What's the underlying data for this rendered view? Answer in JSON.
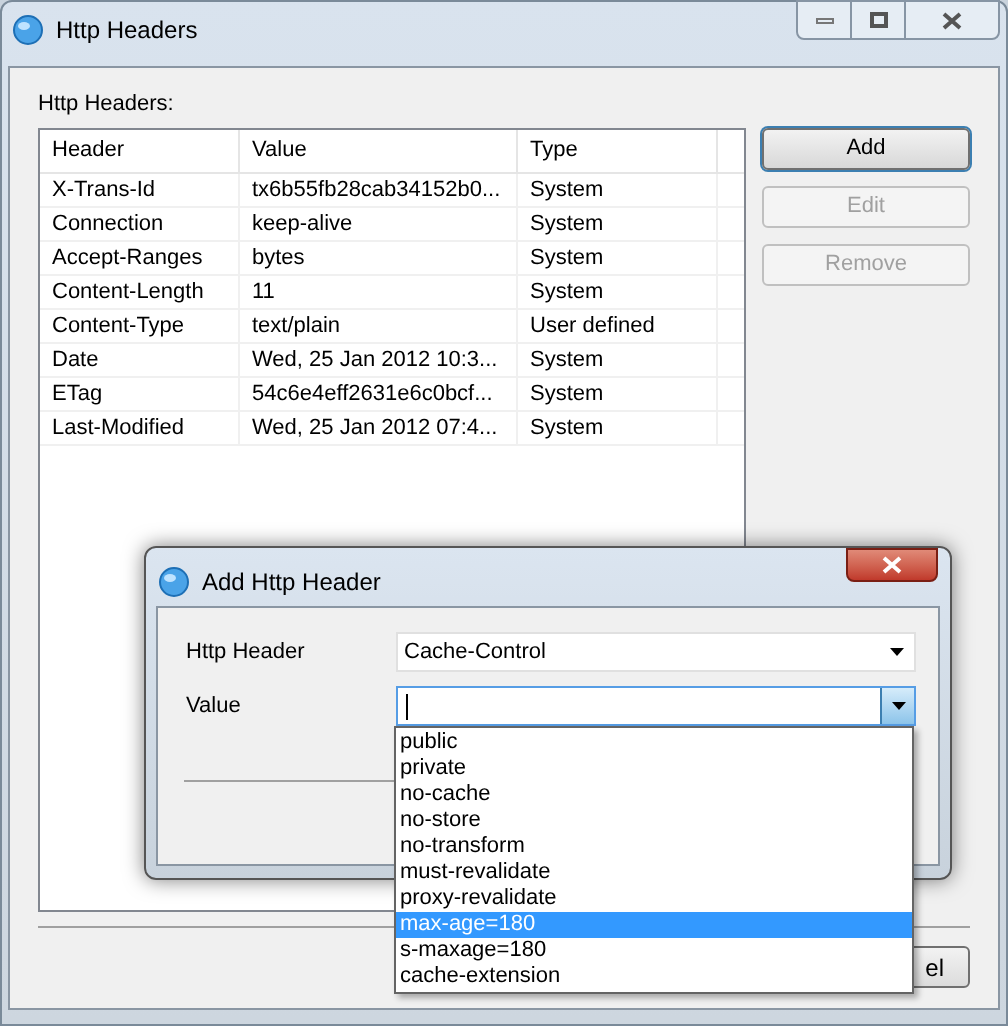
{
  "window": {
    "title": "Http Headers"
  },
  "list_label": "Http Headers:",
  "table": {
    "columns": [
      "Header",
      "Value",
      "Type"
    ],
    "rows": [
      [
        "X-Trans-Id",
        "tx6b55fb28cab34152b0...",
        "System"
      ],
      [
        "Connection",
        "keep-alive",
        "System"
      ],
      [
        "Accept-Ranges",
        "bytes",
        "System"
      ],
      [
        "Content-Length",
        "11",
        "System"
      ],
      [
        "Content-Type",
        "text/plain",
        "User defined"
      ],
      [
        "Date",
        "Wed, 25 Jan 2012 10:3...",
        "System"
      ],
      [
        "ETag",
        "54c6e4eff2631e6c0bcf...",
        "System"
      ],
      [
        "Last-Modified",
        "Wed, 25 Jan 2012 07:4...",
        "System"
      ]
    ]
  },
  "buttons": [
    {
      "label": "Add",
      "disabled": false,
      "default": true
    },
    {
      "label": "Edit",
      "disabled": true,
      "default": false
    },
    {
      "label": "Remove",
      "disabled": true,
      "default": false
    }
  ],
  "bottom_button": {
    "label": "el"
  },
  "dialog": {
    "title": "Add Http Header",
    "fields": [
      {
        "label": "Http Header",
        "value": "Cache-Control",
        "focused": false
      },
      {
        "label": "Value",
        "focused": true
      }
    ],
    "dropdown_options": [
      {
        "label": "public",
        "selected": false
      },
      {
        "label": "private",
        "selected": false
      },
      {
        "label": "no-cache",
        "selected": false
      },
      {
        "label": "no-store",
        "selected": false
      },
      {
        "label": "no-transform",
        "selected": false
      },
      {
        "label": "must-revalidate",
        "selected": false
      },
      {
        "label": "proxy-revalidate",
        "selected": false
      },
      {
        "label": "max-age=180",
        "selected": true
      },
      {
        "label": "s-maxage=180",
        "selected": false
      },
      {
        "label": "cache-extension",
        "selected": false
      }
    ]
  }
}
